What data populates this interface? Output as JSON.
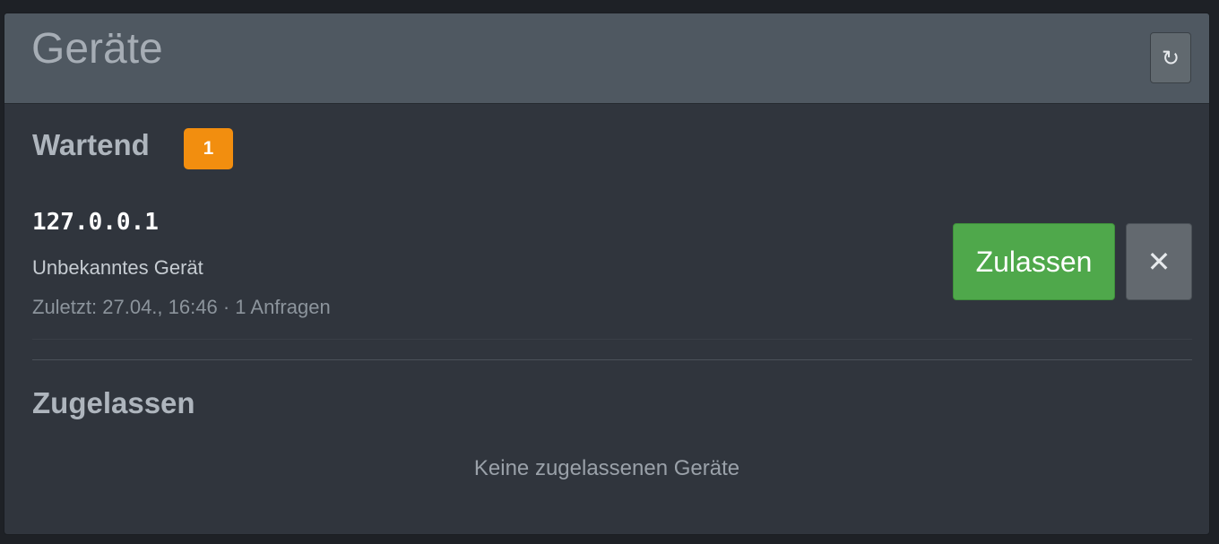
{
  "panel": {
    "title": "Geräte",
    "refresh_icon": "↻"
  },
  "pending": {
    "heading": "Wartend",
    "count": "1",
    "devices": [
      {
        "ip": "127.0.0.1",
        "name": "Unbekanntes Gerät",
        "last_seen": "Zuletzt: 27.04., 16:46",
        "separator": " · ",
        "requests": "1 Anfragen",
        "approve_label": "Zulassen",
        "reject_icon": "✕"
      }
    ]
  },
  "approved": {
    "heading": "Zugelassen",
    "empty_text": "Keine zugelassenen Geräte"
  },
  "colors": {
    "panel_bg": "#30353d",
    "header_bg": "#4f5861",
    "badge": "#f28e0f",
    "approve": "#4fa84b",
    "reject": "#63696f"
  }
}
